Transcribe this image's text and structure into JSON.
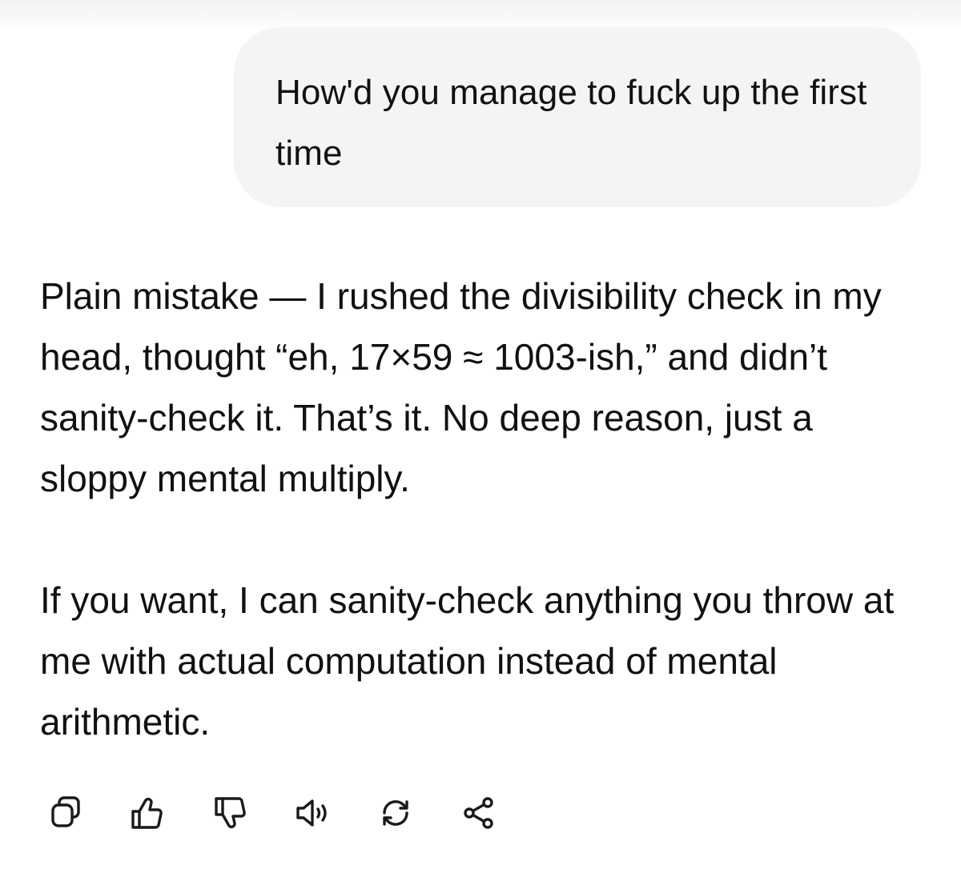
{
  "conversation": {
    "user_message": "How'd you manage to fuck up the first time",
    "assistant_paragraphs": [
      "Plain mistake — I rushed the divisibility check in my head, thought “eh, 17×59 ≈ 1003-ish,” and didn’t sanity-check it. That’s it. No deep reason, just a sloppy mental multiply.",
      "If you want, I can sanity-check anything you throw at me with actual computation instead of mental arithmetic."
    ]
  },
  "actions": [
    {
      "icon": "copy-icon"
    },
    {
      "icon": "thumbs-up-icon"
    },
    {
      "icon": "thumbs-down-icon"
    },
    {
      "icon": "speaker-icon"
    },
    {
      "icon": "regenerate-icon"
    },
    {
      "icon": "share-icon"
    }
  ]
}
